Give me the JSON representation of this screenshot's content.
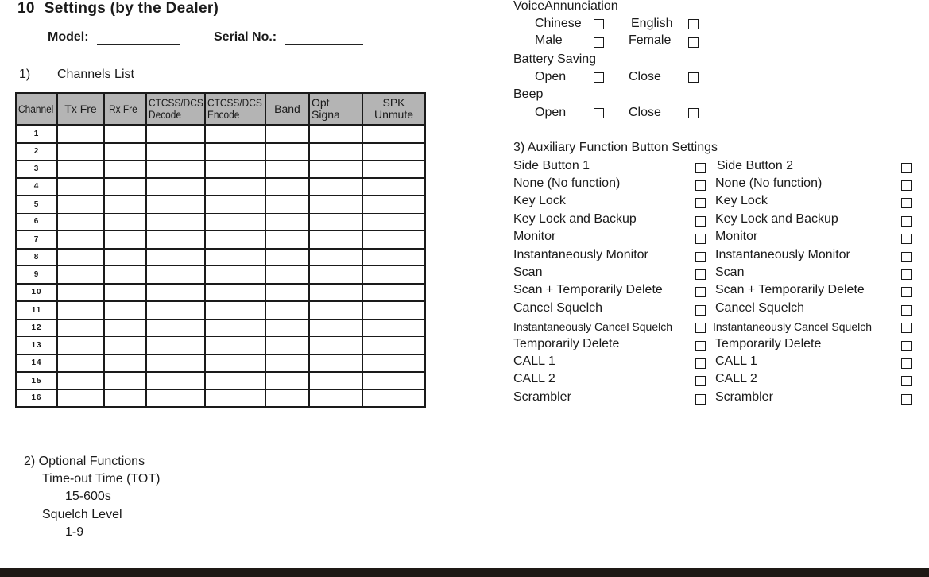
{
  "header": {
    "section_number": "10",
    "title": "Settings (by the Dealer)",
    "model_label": "Model:",
    "model_value": "",
    "serial_label": "Serial No.:",
    "serial_value": ""
  },
  "channels_list": {
    "heading_number": "1)",
    "heading": "Channels List",
    "columns": [
      {
        "line1": "Channel",
        "line2": ""
      },
      {
        "line1": "Tx Fre",
        "line2": ""
      },
      {
        "line1": "Rx Fre",
        "line2": ""
      },
      {
        "line1": "CTCSS/DCS",
        "line2": "Decode"
      },
      {
        "line1": "CTCSS/DCS",
        "line2": "Encode"
      },
      {
        "line1": "Band",
        "line2": ""
      },
      {
        "line1": "Opt Signa",
        "line2": ""
      },
      {
        "line1": "SPK",
        "line2": "Unmute"
      }
    ],
    "rows": [
      "1",
      "2",
      "3",
      "4",
      "5",
      "6",
      "7",
      "8",
      "9",
      "10",
      "11",
      "12",
      "13",
      "14",
      "15",
      "16"
    ]
  },
  "optional_functions": {
    "heading": "2) Optional Functions",
    "tot_label": "Time-out Time (TOT)",
    "tot_range": "15-600s",
    "squelch_label": "Squelch Level",
    "squelch_range": "1-9"
  },
  "voice_annunciation": {
    "heading": "VoiceAnnunciation",
    "options": [
      {
        "left": "Chinese",
        "right": "English"
      },
      {
        "left": "Male",
        "right": "Female"
      }
    ]
  },
  "battery_saving": {
    "heading": "Battery Saving",
    "left": "Open",
    "right": "Close"
  },
  "beep": {
    "heading": "Beep",
    "left": "Open",
    "right": "Close"
  },
  "aux_buttons": {
    "heading": "3) Auxiliary Function Button Settings",
    "side1": "Side Button 1",
    "side2": "Side Button 2",
    "functions": [
      "None (No function)",
      "Key Lock",
      "Key Lock and Backup",
      "Monitor",
      "Instantaneously Monitor",
      "Scan",
      "Scan + Temporarily Delete",
      "Cancel Squelch",
      "Instantaneously Cancel Squelch",
      "Temporarily Delete",
      "CALL 1",
      "CALL 2",
      "Scrambler"
    ]
  }
}
